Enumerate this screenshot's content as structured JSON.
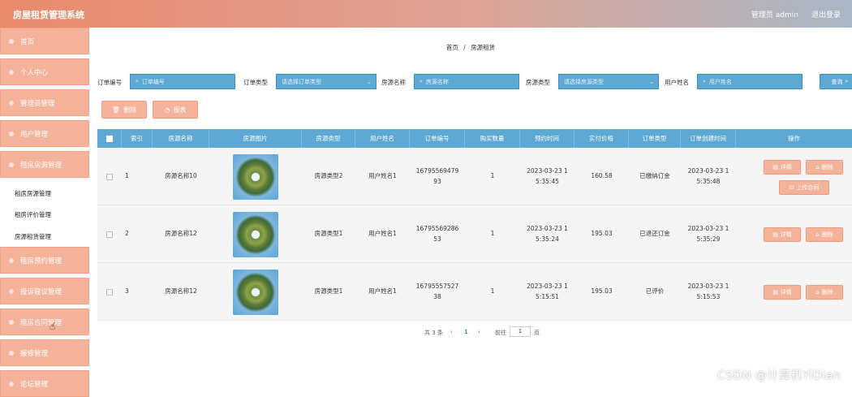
{
  "app": {
    "title": "房屋租赁管理系统",
    "user_label": "管理员 admin",
    "logout": "退出登录"
  },
  "sidebar": {
    "items": [
      {
        "label": "首页"
      },
      {
        "label": "个人中心"
      },
      {
        "label": "管理员管理"
      },
      {
        "label": "用户管理"
      },
      {
        "label": "租房房源管理"
      }
    ],
    "submenu": [
      {
        "label": "租房房源管理"
      },
      {
        "label": "租房评价管理"
      },
      {
        "label": "房源租赁管理"
      }
    ],
    "items_after": [
      {
        "label": "租房预约管理"
      },
      {
        "label": "投诉建议管理"
      },
      {
        "label": "租房合同管理"
      },
      {
        "label": "报修管理"
      },
      {
        "label": "论坛管理"
      }
    ]
  },
  "breadcrumb": {
    "home": "首页",
    "sep": "/",
    "current": "房源租赁"
  },
  "filters": {
    "order_no": {
      "label": "订单编号",
      "placeholder": "订单编号"
    },
    "order_type": {
      "label": "订单类型",
      "placeholder": "请选择订单类型"
    },
    "house_name": {
      "label": "房源名称",
      "placeholder": "房源名称"
    },
    "house_type": {
      "label": "房源类型",
      "placeholder": "请选择房源类型"
    },
    "user_name": {
      "label": "用户姓名",
      "placeholder": "用户姓名"
    },
    "search_label": "查询"
  },
  "toolbar": {
    "delete_label": "删除",
    "report_label": "报表"
  },
  "table": {
    "headers": [
      "索引",
      "房源名称",
      "房源图片",
      "房源类型",
      "用户姓名",
      "订单编号",
      "购买数量",
      "预约时间",
      "实付价格",
      "订单类型",
      "订单创建时间",
      "操作"
    ],
    "rows": [
      {
        "index": "1",
        "house_name": "房源名称10",
        "house_type": "房源类型2",
        "user_name": "用户姓名1",
        "order_no": "16795569479 93",
        "qty": "1",
        "book_time": "2023-03-23 1 5:35:45",
        "price": "160.58",
        "order_type": "已缴纳订金",
        "created": "2023-03-23 1 5:35:48"
      },
      {
        "index": "2",
        "house_name": "房源名称12",
        "house_type": "房源类型1",
        "user_name": "用户姓名1",
        "order_no": "16795569286 53",
        "qty": "1",
        "book_time": "2023-03-23 1 5:35:24",
        "price": "195.03",
        "order_type": "已退还订金",
        "created": "2023-03-23 1 5:35:29"
      },
      {
        "index": "3",
        "house_name": "房源名称12",
        "house_type": "房源类型1",
        "user_name": "用户姓名1",
        "order_no": "16795557527 38",
        "qty": "1",
        "book_time": "2023-03-23 1 5:15:51",
        "price": "195.03",
        "order_type": "已评价",
        "created": "2023-03-23 1 5:15:53"
      }
    ],
    "ops": {
      "detail": "详情",
      "delete": "删除",
      "contract": "上传合同"
    }
  },
  "pager": {
    "total": "共 3 条",
    "prev": "‹",
    "page": "1",
    "next": "›",
    "goto": "前往",
    "page_input": "1",
    "page_suffix": "页"
  },
  "watermark": "CSDN @计算机YiDian",
  "colors": {
    "accent": "#f6b39c",
    "header_blue": "#5ea9d4"
  }
}
